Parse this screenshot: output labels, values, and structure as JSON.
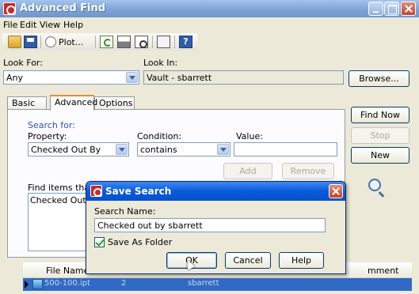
{
  "window": {
    "title": "Advanced Find"
  },
  "menu": [
    "File",
    "Edit",
    "View",
    "Help"
  ],
  "toolbar": {
    "plot_label": "Plot..."
  },
  "look_for": {
    "label": "Look For:",
    "value": "Any"
  },
  "look_in": {
    "label": "Look In:",
    "value": "Vault - sbarrett",
    "browse_label": "Browse..."
  },
  "tabs": [
    {
      "label": "Basic"
    },
    {
      "label": "Advanced"
    },
    {
      "label": "Options"
    }
  ],
  "criteria": {
    "group_label": "Search for:",
    "property_label": "Property:",
    "property_value": "Checked Out By",
    "condition_label": "Condition:",
    "condition_value": "contains",
    "value_label": "Value:",
    "value_text": "",
    "add_label": "Add",
    "remove_label": "Remove",
    "list_label": "Find items that m",
    "list_items": [
      "Checked Out By"
    ]
  },
  "side_buttons": {
    "find_now": "Find Now",
    "stop": "Stop",
    "new": "New"
  },
  "results": {
    "headers": [
      "File Name",
      "mment"
    ],
    "row": {
      "name": "500-100.ipt",
      "col2": "2",
      "col3": "sbarrett"
    }
  },
  "dialog": {
    "title": "Save Search",
    "name_label": "Search Name:",
    "name_value": "Checked out by sbarrett",
    "checkbox_label": "Save As Folder",
    "checkbox_checked": true,
    "ok_label": "OK",
    "cancel_label": "Cancel",
    "help_label": "Help"
  }
}
